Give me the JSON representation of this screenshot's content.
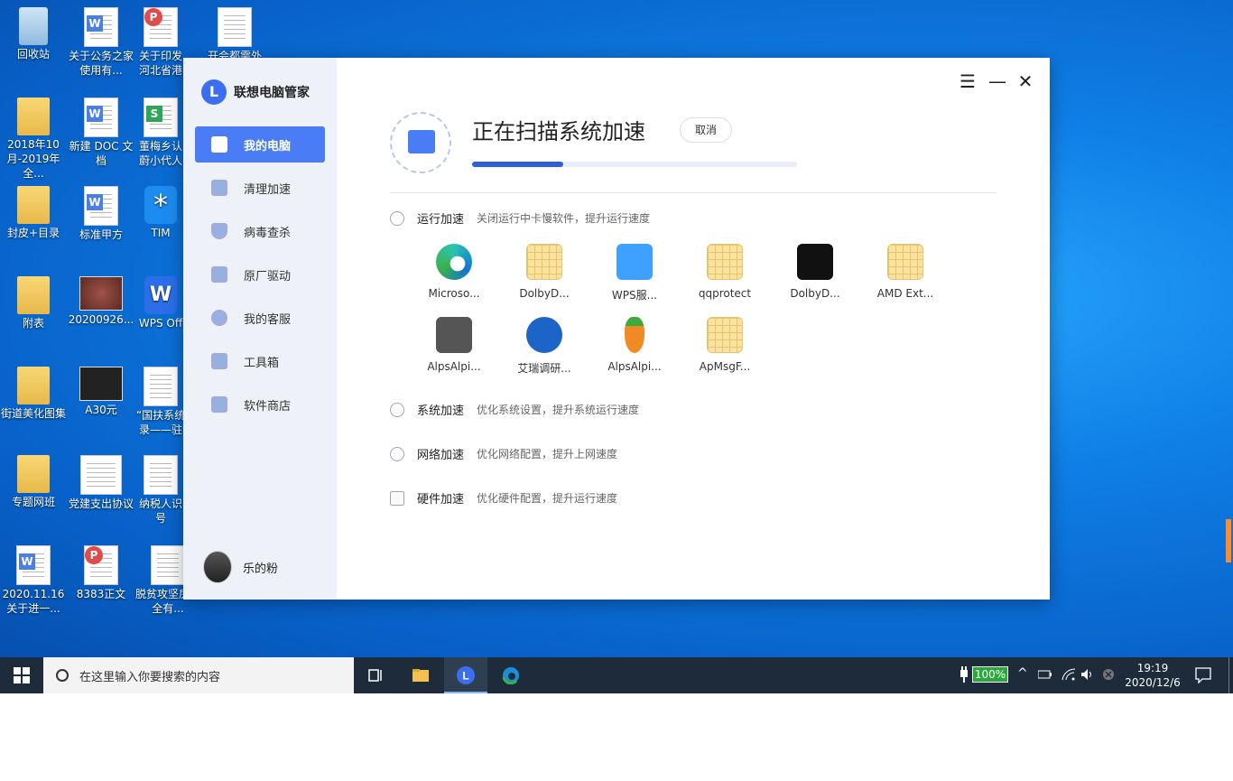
{
  "desktop": {
    "icons": [
      {
        "label": "回收站",
        "type": "recycle"
      },
      {
        "label": "关于公务之家使用有...",
        "type": "word"
      },
      {
        "label": "关于印发河北省港",
        "type": "pdf"
      },
      {
        "label": "开会都需外",
        "type": "doc"
      },
      {
        "label": "2018年10月-2019年全...",
        "type": "folder"
      },
      {
        "label": "新建 DOC 文档",
        "type": "word"
      },
      {
        "label": "董梅乡认蔚小代人",
        "type": "sheet"
      },
      {
        "label": "封皮+目录",
        "type": "folder"
      },
      {
        "label": "标准甲方",
        "type": "word"
      },
      {
        "label": "TIM",
        "type": "tim"
      },
      {
        "label": "附表",
        "type": "folder"
      },
      {
        "label": "20200926...",
        "type": "photo"
      },
      {
        "label": "WPS Off",
        "type": "wps"
      },
      {
        "label": "街道美化图集",
        "type": "folder"
      },
      {
        "label": "A30元",
        "type": "photo"
      },
      {
        "label": "“国扶系统录——驻",
        "type": "doc"
      },
      {
        "label": "专题网班",
        "type": "folder"
      },
      {
        "label": "党建支出协议",
        "type": "doc"
      },
      {
        "label": "纳税人识号",
        "type": "doc"
      },
      {
        "label": "2020.11.16关于进一...",
        "type": "word"
      },
      {
        "label": "8383正文",
        "type": "pdf"
      },
      {
        "label": "脱贫攻坚房安全有..."
      }
    ]
  },
  "app": {
    "brand": "联想电脑管家",
    "nav": [
      {
        "label": "我的电脑",
        "icon": "computer-icon",
        "active": true
      },
      {
        "label": "清理加速",
        "icon": "broom-icon"
      },
      {
        "label": "病毒查杀",
        "icon": "shield-icon"
      },
      {
        "label": "原厂驱动",
        "icon": "driver-icon"
      },
      {
        "label": "我的客服",
        "icon": "headset-icon"
      },
      {
        "label": "工具箱",
        "icon": "toolbox-icon"
      },
      {
        "label": "软件商店",
        "icon": "store-bag-icon"
      }
    ],
    "user": "乐的粉",
    "scan_title": "正在扫描系统加速",
    "cancel": "取消",
    "progress": 0.28,
    "sections": [
      {
        "title": "运行加速",
        "desc": "关闭运行中卡慢软件，提升运行速度",
        "icon": "speedometer-icon"
      },
      {
        "title": "系统加速",
        "desc": "优化系统设置，提升系统运行速度",
        "icon": "system-icon"
      },
      {
        "title": "网络加速",
        "desc": "优化网络配置，提升上网速度",
        "icon": "wifi-icon"
      },
      {
        "title": "硬件加速",
        "desc": "优化硬件配置，提升运行速度",
        "icon": "hardware-icon"
      }
    ],
    "apps": [
      {
        "label": "Microso...",
        "icon": "edge"
      },
      {
        "label": "DolbyD...",
        "icon": "sheet"
      },
      {
        "label": "WPS服...",
        "icon": "wps"
      },
      {
        "label": "qqprotect",
        "icon": "sheet"
      },
      {
        "label": "DolbyD...",
        "icon": "dolby"
      },
      {
        "label": "AMD Ext...",
        "icon": "sheet"
      },
      {
        "label": "AlpsAlpi...",
        "icon": "robot"
      },
      {
        "label": "艾瑞调研...",
        "icon": "check"
      },
      {
        "label": "AlpsAlpi...",
        "icon": "carrot"
      },
      {
        "label": "ApMsgF...",
        "icon": "sheet"
      }
    ]
  },
  "taskbar": {
    "search_placeholder": "在这里输入你要搜索的内容",
    "battery": "100%",
    "time": "19:19",
    "date": "2020/12/6"
  }
}
